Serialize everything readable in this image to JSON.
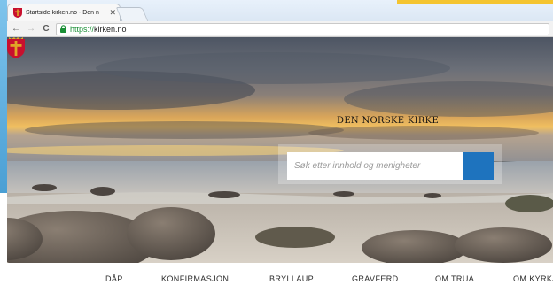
{
  "browser": {
    "tab": {
      "title": "Startside kirken.no - Den n",
      "close_glyph": "✕"
    },
    "toolbar": {
      "back_glyph": "←",
      "forward_glyph": "→",
      "reload_glyph": "C",
      "url_scheme": "https://",
      "url_host": "kirken.no"
    }
  },
  "site": {
    "logo_text": "DEN NORSKE KIRKE",
    "search": {
      "placeholder": "Søk etter innhold og menigheter"
    },
    "nav": [
      "DÅP",
      "KONFIRMASJON",
      "BRYLLAUP",
      "GRAVFERD",
      "OM TRUA",
      "OM KYRKJA"
    ]
  },
  "colors": {
    "accent_blue": "#1e73be",
    "logo_red": "#c8102e",
    "logo_gold": "#e0a526",
    "secure_green": "#1a8f36"
  },
  "icons": {
    "favicon": "church-shield-icon",
    "secure": "lock-icon",
    "search": "search-icon"
  }
}
